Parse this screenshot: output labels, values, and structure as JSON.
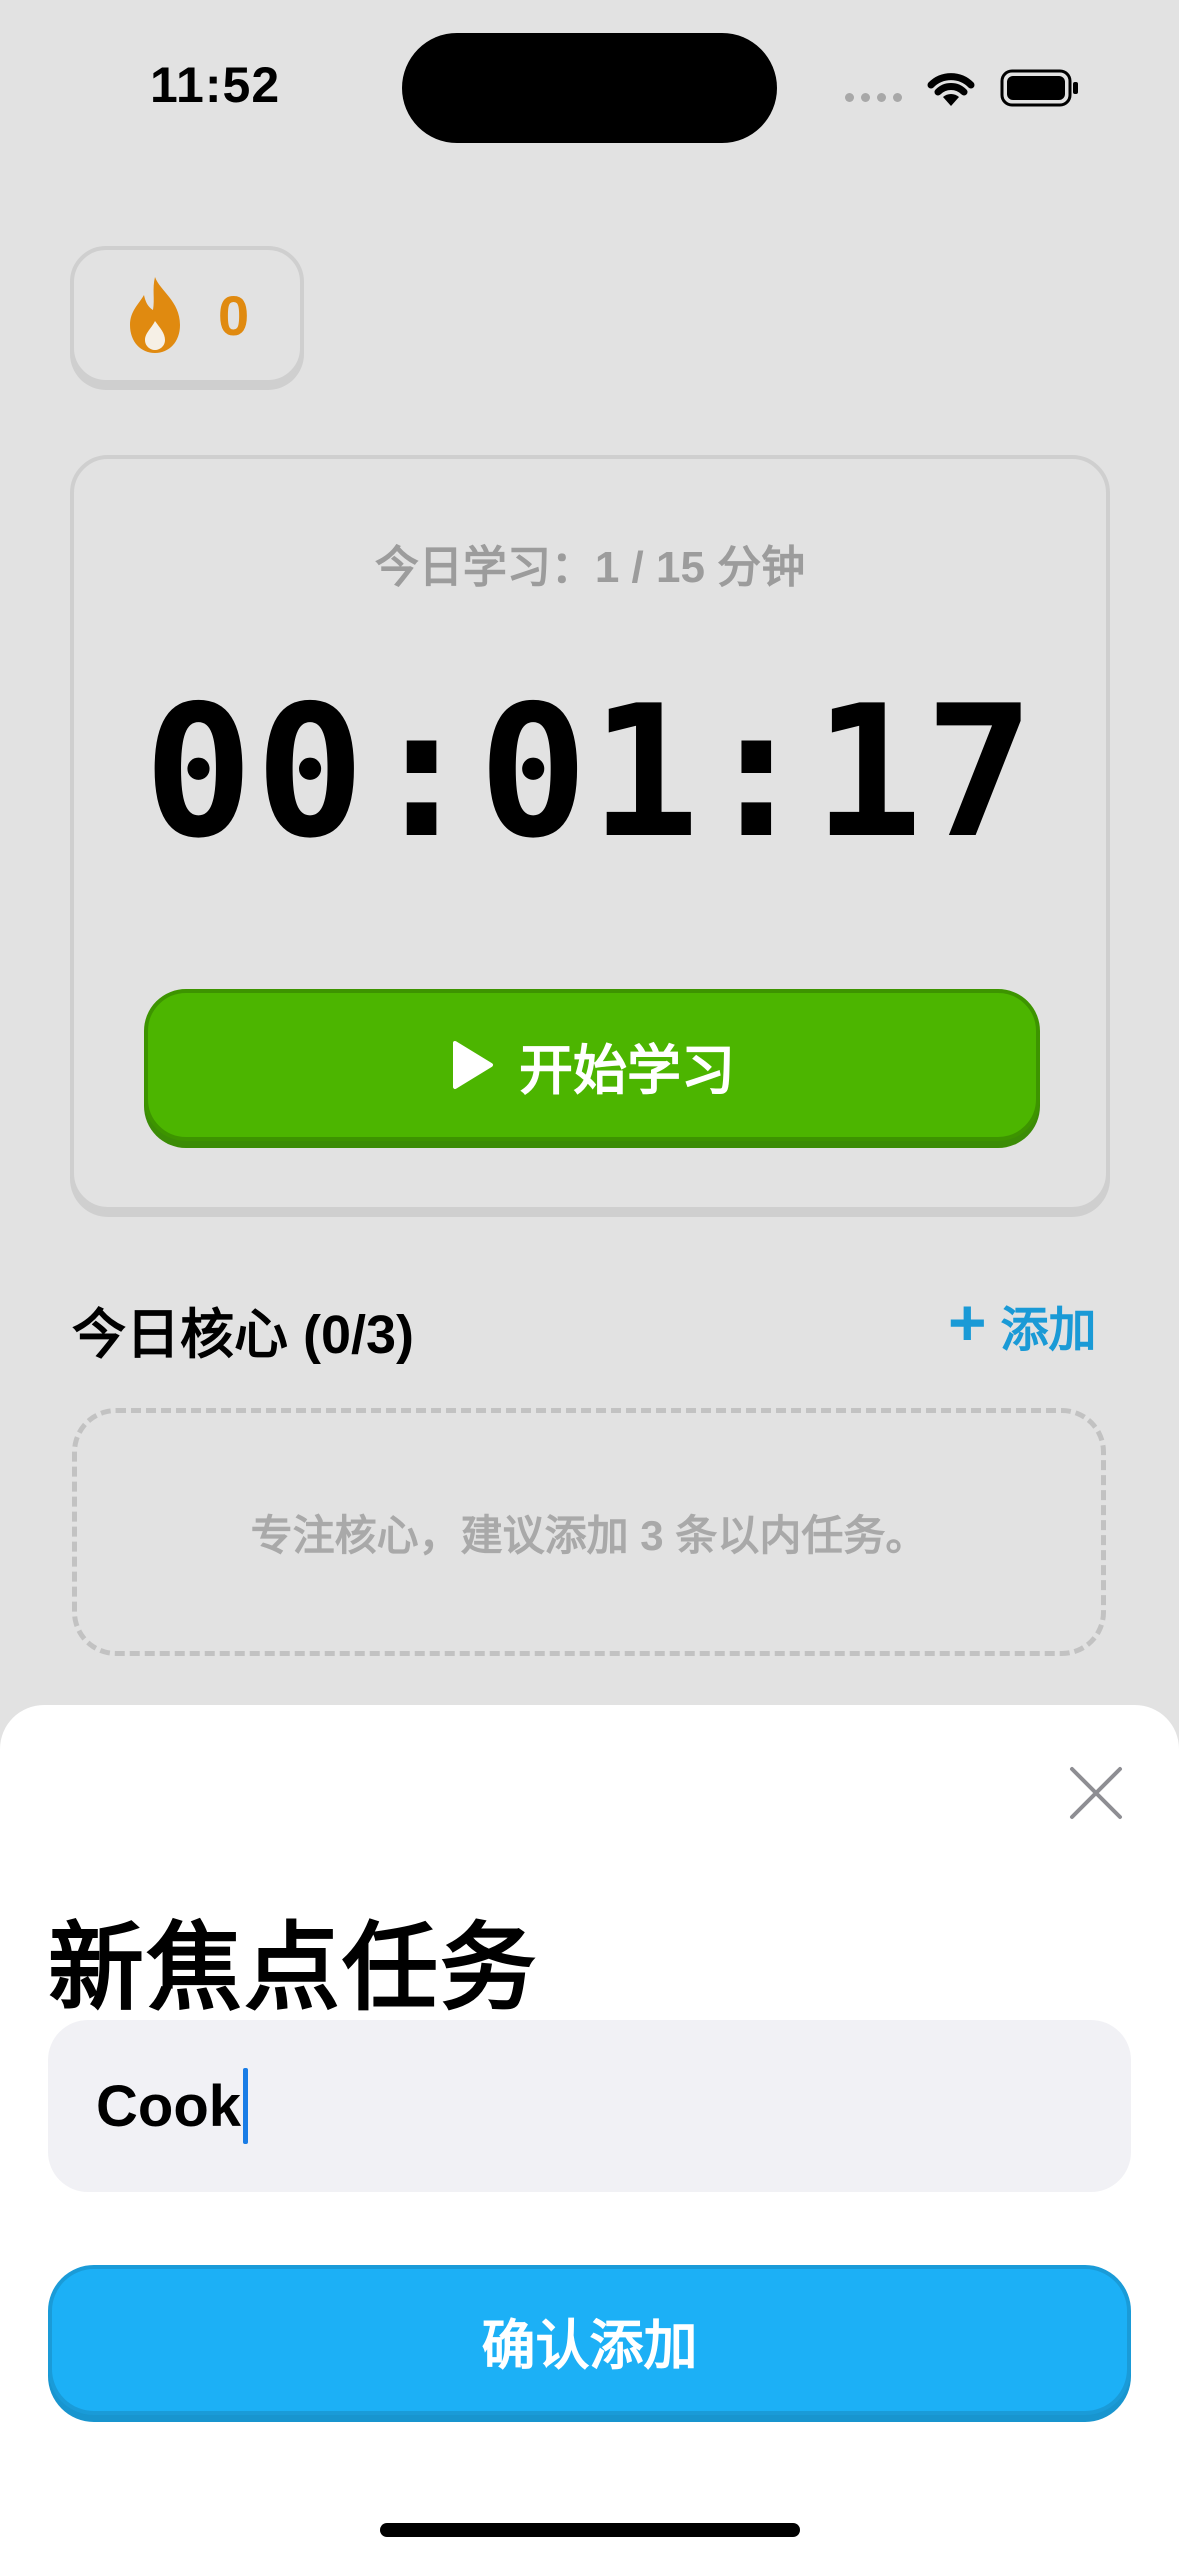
{
  "status_bar": {
    "time": "11:52"
  },
  "streak": {
    "icon": "flame-icon",
    "count": "0",
    "color": "#e08a10"
  },
  "timer_card": {
    "today_study": "今日学习：1 / 15 分钟",
    "elapsed": "00:01:17",
    "start_button_label": "开始学习",
    "start_button_color": "#4cb500"
  },
  "core_section": {
    "title": "今日核心 (0/3)",
    "add_icon": "+",
    "add_label": "添加",
    "empty_hint": "专注核心，建议添加 3 条以内任务。"
  },
  "sheet": {
    "title": "新焦点任务",
    "input_value": "Cook",
    "confirm_label": "确认添加",
    "confirm_color": "#1cb0f6"
  }
}
